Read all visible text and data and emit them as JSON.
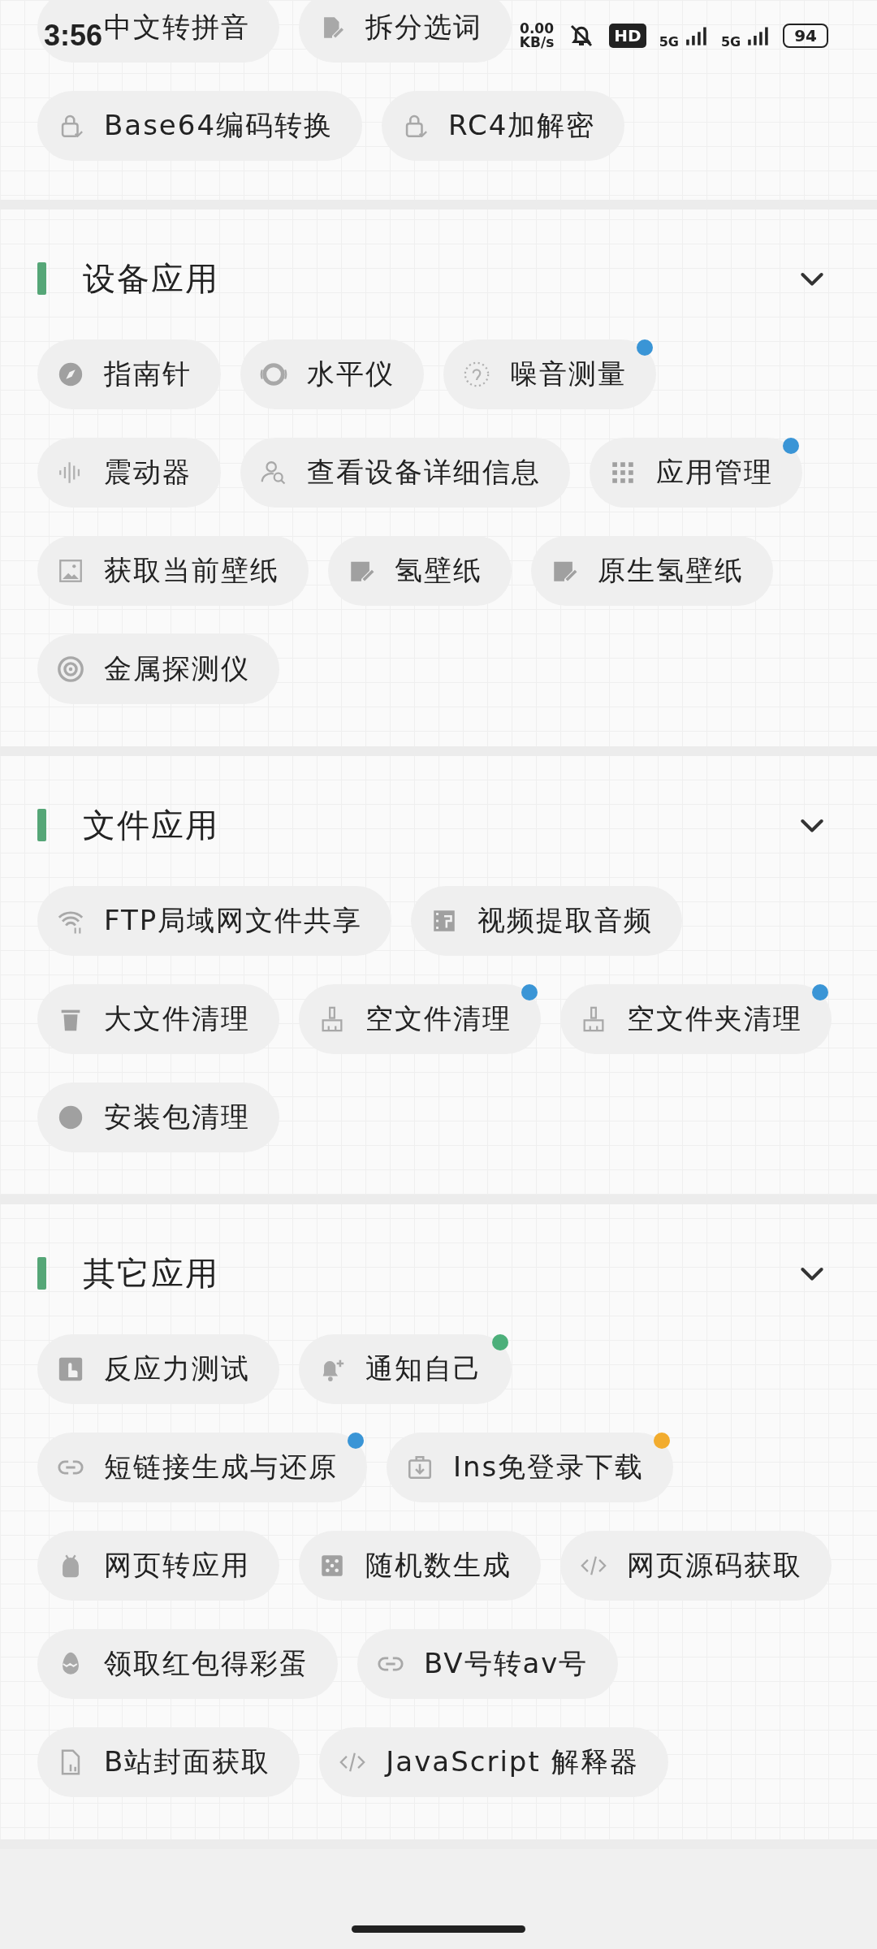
{
  "status_bar": {
    "time": "3:56",
    "speed_value": "0.00",
    "speed_unit": "KB/s",
    "hd": "HD",
    "networks": [
      "5G",
      "5G"
    ],
    "battery": "94"
  },
  "sections": [
    {
      "rows": [
        [
          {
            "label": "中文转拼音"
          },
          {
            "label": "拆分选词"
          }
        ],
        [
          {
            "label": "Base64编码转换"
          },
          {
            "label": "RC4加解密"
          }
        ]
      ]
    },
    {
      "title": "设备应用",
      "rows": [
        [
          {
            "label": "指南针"
          },
          {
            "label": "水平仪"
          },
          {
            "label": "噪音测量",
            "color": "#3a95d6"
          }
        ],
        [
          {
            "label": "震动器"
          },
          {
            "label": "查看设备详细信息"
          },
          {
            "label": "应用管理",
            "color": "#3a95d6"
          }
        ],
        [
          {
            "label": "获取当前壁纸"
          },
          {
            "label": "氢壁纸"
          },
          {
            "label": "原生氢壁纸"
          }
        ],
        [
          {
            "label": "金属探测仪"
          }
        ]
      ]
    },
    {
      "title": "文件应用",
      "rows": [
        [
          {
            "label": "FTP局域网文件共享"
          },
          {
            "label": "视频提取音频"
          }
        ],
        [
          {
            "label": "大文件清理"
          },
          {
            "label": "空文件清理",
            "color": "#3a95d6"
          },
          {
            "label": "空文件夹清理",
            "color": "#3a95d6"
          }
        ],
        [
          {
            "label": "安装包清理"
          }
        ]
      ]
    },
    {
      "title": "其它应用",
      "rows": [
        [
          {
            "label": "反应力测试"
          },
          {
            "label": "通知自己",
            "color": "#4caf7a"
          }
        ],
        [
          {
            "label": "短链接生成与还原",
            "color": "#3a95d6"
          },
          {
            "label": "Ins免登录下载",
            "color": "#f2ac2e"
          }
        ],
        [
          {
            "label": "网页转应用"
          },
          {
            "label": "随机数生成"
          },
          {
            "label": "网页源码获取"
          }
        ],
        [
          {
            "label": "领取红包得彩蛋"
          },
          {
            "label": "BV号转av号"
          }
        ],
        [
          {
            "label": "B站封面获取"
          },
          {
            "label": "JavaScript 解释器"
          }
        ]
      ]
    }
  ]
}
